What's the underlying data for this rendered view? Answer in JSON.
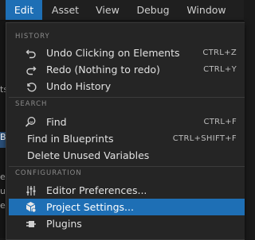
{
  "menubar": {
    "items": [
      {
        "label": "Edit"
      },
      {
        "label": "Asset"
      },
      {
        "label": "View"
      },
      {
        "label": "Debug"
      },
      {
        "label": "Window"
      }
    ]
  },
  "background": {
    "fragments": [
      "ts",
      "B",
      "e",
      "u",
      "e"
    ]
  },
  "dropdown": {
    "sections": {
      "history": "HISTORY",
      "search": "SEARCH",
      "configuration": "CONFIGURATION"
    },
    "items": {
      "undo": {
        "label": "Undo Clicking on Elements",
        "shortcut": "CTRL+Z",
        "icon": "undo-icon"
      },
      "redo": {
        "label": "Redo (Nothing to redo)",
        "shortcut": "CTRL+Y",
        "icon": "redo-icon"
      },
      "undo_history": {
        "label": "Undo History",
        "icon": "history-icon"
      },
      "find": {
        "label": "Find",
        "shortcut": "CTRL+F",
        "icon": "find-icon"
      },
      "find_in_blueprints": {
        "label": "Find in Blueprints",
        "shortcut": "CTRL+SHIFT+F"
      },
      "delete_unused": {
        "label": "Delete Unused Variables"
      },
      "editor_prefs": {
        "label": "Editor Preferences...",
        "icon": "sliders-icon"
      },
      "project_settings": {
        "label": "Project Settings...",
        "icon": "project-settings-icon"
      },
      "plugins": {
        "label": "Plugins",
        "icon": "plugin-icon"
      }
    }
  },
  "colors": {
    "accent": "#1e6fb5",
    "panel": "#252525",
    "text": "#e2e2e2",
    "section_header": "#8a8a8a"
  }
}
